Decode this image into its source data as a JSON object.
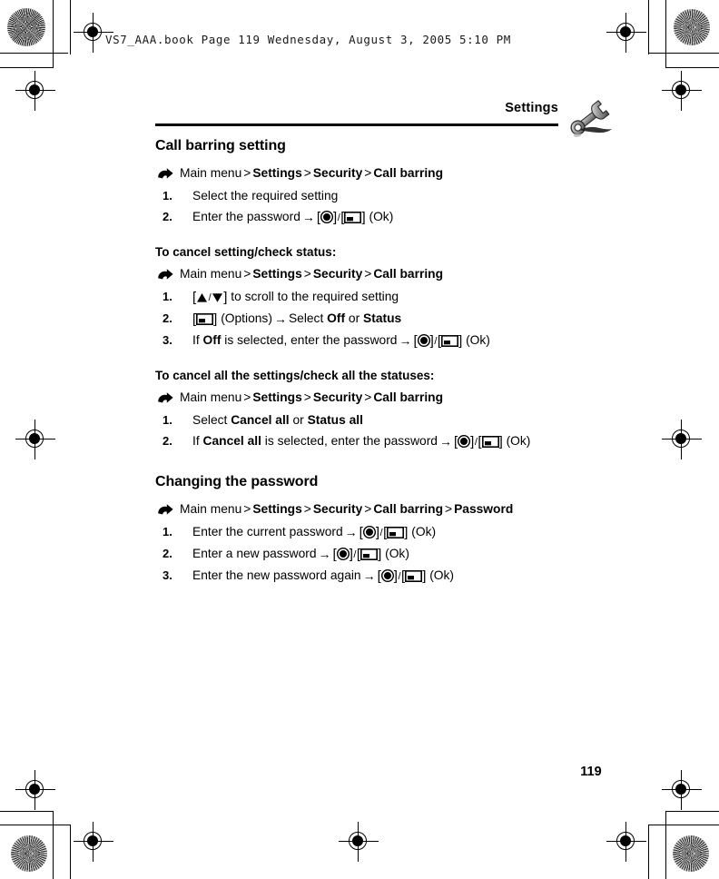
{
  "print_header": "VS7_AAA.book  Page 119  Wednesday, August 3, 2005  5:10 PM",
  "running_head": "Settings",
  "chapter_icon": "wrench-icon",
  "page_number": "119",
  "sections": [
    {
      "title": "Call barring setting",
      "blocks": [
        {
          "type": "nav",
          "bullet": "arrow-bullet-icon",
          "parts": [
            "Main menu",
            "Settings",
            "Security",
            "Call barring"
          ],
          "text": "Main menu > Settings > Security > Call barring"
        },
        {
          "type": "steps",
          "items": [
            {
              "num": "1.",
              "text": "Select the required setting"
            },
            {
              "num": "2.",
              "text": "Enter the password → [●]/[▭] (Ok)"
            }
          ]
        }
      ]
    },
    {
      "subhead": "To cancel setting/check status:",
      "blocks": [
        {
          "type": "nav",
          "bullet": "arrow-bullet-icon",
          "parts": [
            "Main menu",
            "Settings",
            "Security",
            "Call barring"
          ],
          "text": "Main menu > Settings > Security > Call barring"
        },
        {
          "type": "steps",
          "items": [
            {
              "num": "1.",
              "text": "[▲/▼] to scroll to the required setting"
            },
            {
              "num": "2.",
              "text": "[▭] (Options) → Select Off or Status"
            },
            {
              "num": "3.",
              "text": "If Off is selected, enter the password → [●]/[▭] (Ok)"
            }
          ]
        }
      ]
    },
    {
      "subhead": "To cancel all the settings/check all the statuses:",
      "blocks": [
        {
          "type": "nav",
          "bullet": "arrow-bullet-icon",
          "parts": [
            "Main menu",
            "Settings",
            "Security",
            "Call barring"
          ],
          "text": "Main menu > Settings > Security > Call barring"
        },
        {
          "type": "steps",
          "items": [
            {
              "num": "1.",
              "text": "Select Cancel all or Status all"
            },
            {
              "num": "2.",
              "text": "If Cancel all is selected, enter the password → [●]/[▭] (Ok)"
            }
          ]
        }
      ]
    },
    {
      "title": "Changing the password",
      "blocks": [
        {
          "type": "nav",
          "bullet": "arrow-bullet-icon",
          "parts": [
            "Main menu",
            "Settings",
            "Security",
            "Call barring",
            "Password"
          ],
          "text": "Main menu > Settings > Security > Call barring > Password"
        },
        {
          "type": "steps",
          "items": [
            {
              "num": "1.",
              "text": "Enter the current password → [●]/[▭] (Ok)"
            },
            {
              "num": "2.",
              "text": "Enter a new password → [●]/[▭] (Ok)"
            },
            {
              "num": "3.",
              "text": "Enter the new password again → [●]/[▭] (Ok)"
            }
          ]
        }
      ]
    }
  ],
  "labels": {
    "main_menu": "Main menu",
    "settings": "Settings",
    "security": "Security",
    "call_barring": "Call barring",
    "password": "Password",
    "gt": ">",
    "step1": "1.",
    "step2": "2.",
    "step3": "3.",
    "sec1_title": "Call barring setting",
    "sec2_subhead": "To cancel setting/check status:",
    "sec3_subhead": "To cancel all the settings/check all the statuses:",
    "sec4_title": "Changing the password",
    "s1_step1": "Select the required setting",
    "s1_step2_a": "Enter the password",
    "s2_step1_a": "to scroll to the required setting",
    "s2_step2_a": "(Options)",
    "s2_step2_b": "Select",
    "s2_step2_off": "Off",
    "s2_step2_or": "or",
    "s2_step2_status": "Status",
    "s2_step3_if": "If",
    "s2_step3_off": "Off",
    "s2_step3_a": "is selected, enter the password",
    "s3_step1_a": "Select",
    "s3_step1_cancel_all": "Cancel all",
    "s3_step1_or": "or",
    "s3_step1_status_all": "Status all",
    "s3_step2_if": "If",
    "s3_step2_cancel_all": "Cancel all",
    "s3_step2_a": "is selected, enter the password",
    "s4_step1_a": "Enter the current password",
    "s4_step2_a": "Enter a new password",
    "s4_step3_a": "Enter the new password again",
    "ok": "(Ok)",
    "bracket_open": "[",
    "bracket_close": "]",
    "slash": "/",
    "arrow": "→"
  },
  "colors": {
    "ink": "#000000",
    "paper": "#ffffff"
  }
}
